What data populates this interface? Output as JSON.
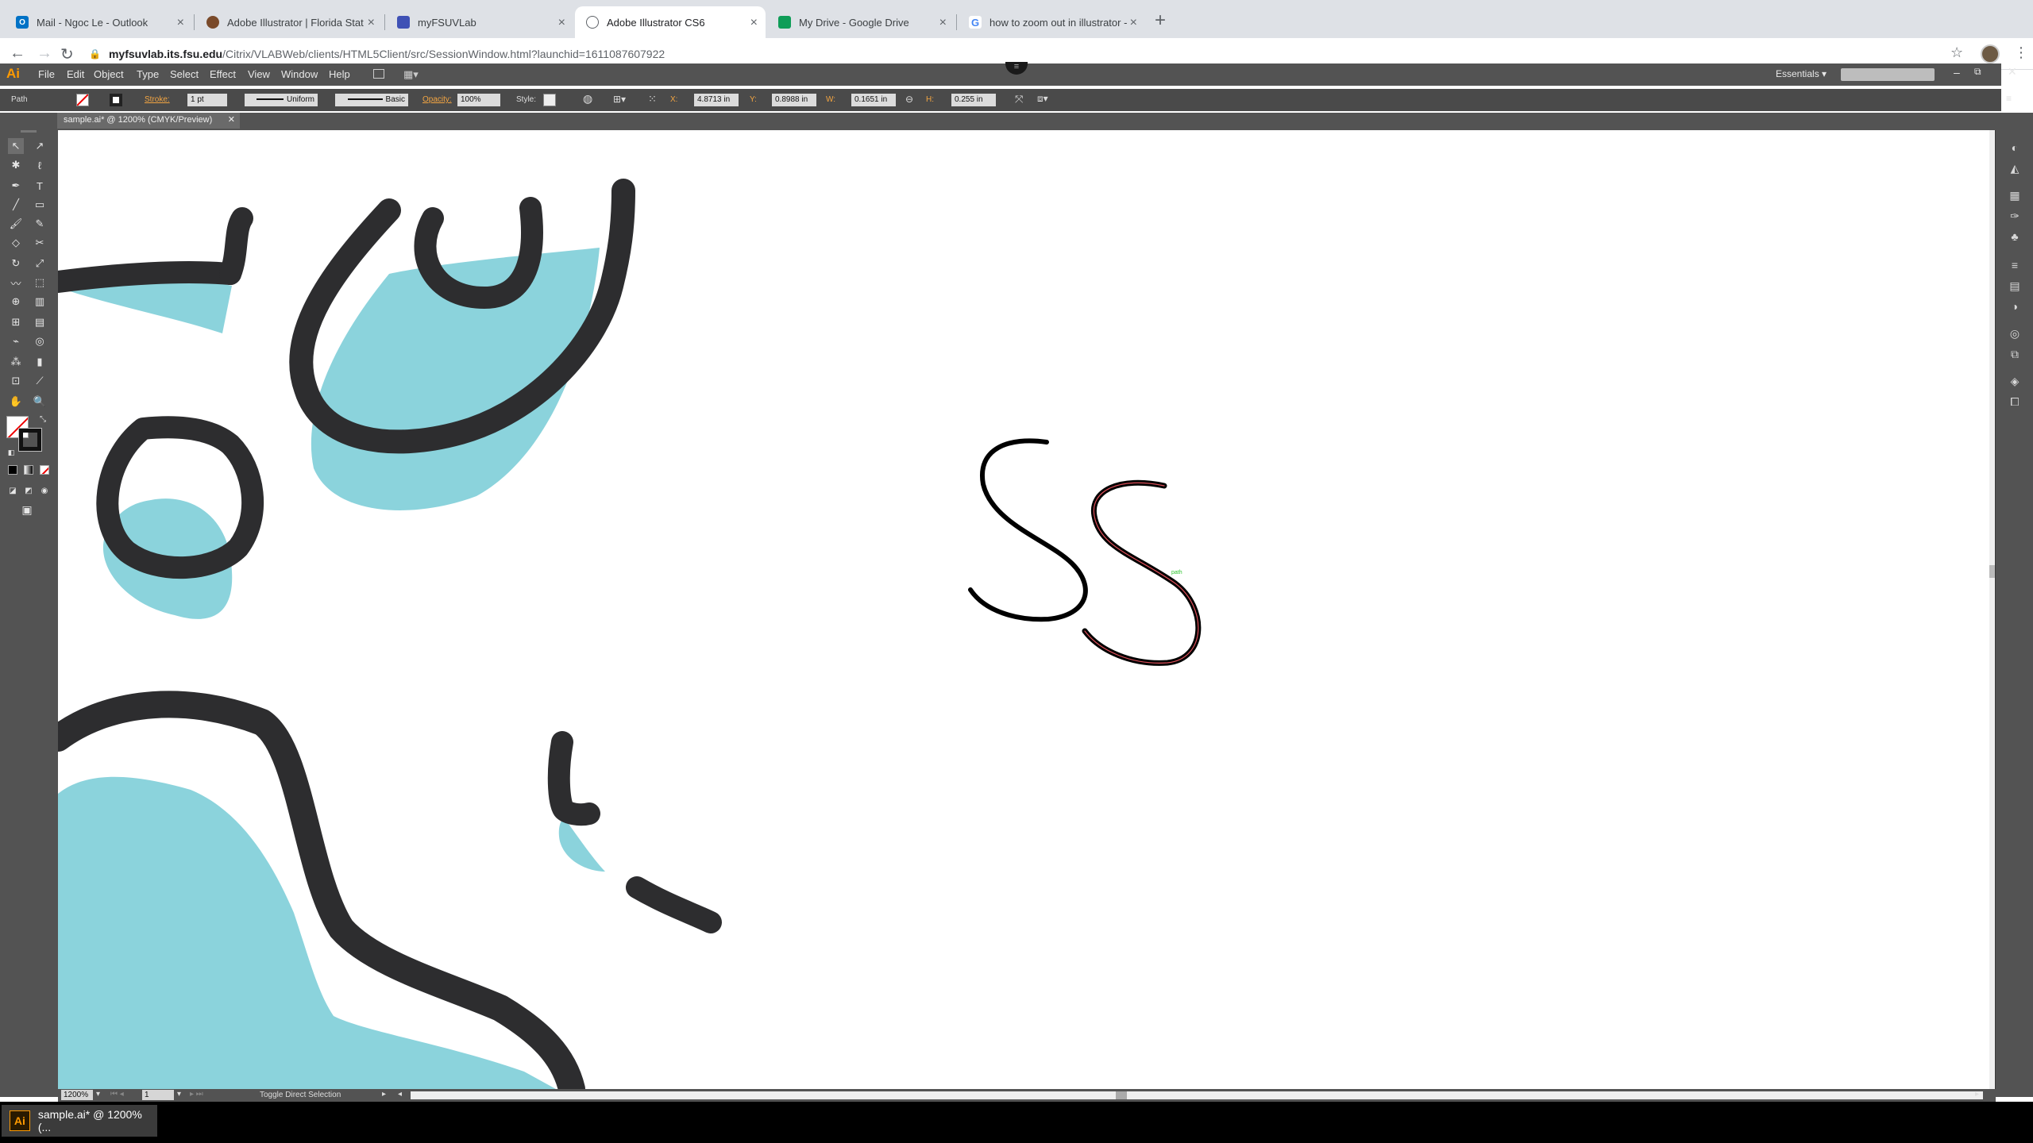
{
  "browser": {
    "tabs": [
      {
        "label": "Mail - Ngoc Le - Outlook",
        "icon": "outlook-icon",
        "color": "#0072c6",
        "active": false
      },
      {
        "label": "Adobe Illustrator | Florida Stat",
        "icon": "fsu-icon",
        "color": "#7a4a2a",
        "active": false
      },
      {
        "label": "myFSUVLab",
        "icon": "citrix-icon",
        "color": "#3f51b5",
        "active": false
      },
      {
        "label": "Adobe Illustrator CS6",
        "icon": "globe-icon",
        "color": "#5f6368",
        "active": true
      },
      {
        "label": "My Drive - Google Drive",
        "icon": "google-drive-icon",
        "color": "#0f9d58",
        "active": false
      },
      {
        "label": "how to zoom out in illustrator -",
        "icon": "google-icon",
        "color": "#4285f4",
        "active": false
      }
    ],
    "new_tab": "+",
    "url_host": "myfsuvlab.its.fsu.edu",
    "url_path": "/Citrix/VLABWeb/clients/HTML5Client/src/SessionWindow.html?launchid=1611087607922"
  },
  "illustrator": {
    "app_icon": "Ai",
    "menu": [
      "File",
      "Edit",
      "Object",
      "Type",
      "Select",
      "Effect",
      "View",
      "Window",
      "Help"
    ],
    "workspace": "Essentials",
    "control_bar": {
      "selection": "Path",
      "stroke_label": "Stroke:",
      "stroke_weight": "1 pt",
      "profile": "Uniform",
      "brush": "Basic",
      "opacity_label": "Opacity:",
      "opacity": "100%",
      "style_label": "Style:",
      "x_label": "X:",
      "x": "4.8713 in",
      "y_label": "Y:",
      "y": "0.8988 in",
      "w_label": "W:",
      "w": "0.1651 in",
      "h_label": "H:",
      "h": "0.255 in"
    },
    "document_tab": "sample.ai* @ 1200% (CMYK/Preview)",
    "status": {
      "zoom": "1200%",
      "artboard": "1",
      "tool_hint": "Toggle Direct Selection"
    },
    "canvas_label": "path",
    "colors": {
      "stroke_dark": "#2d2d2f",
      "fill_teal": "#8bd3dc",
      "selection_red": "#e0505a"
    }
  },
  "taskbar": {
    "app_icon": "Ai",
    "app_label": "sample.ai* @ 1200% (..."
  }
}
